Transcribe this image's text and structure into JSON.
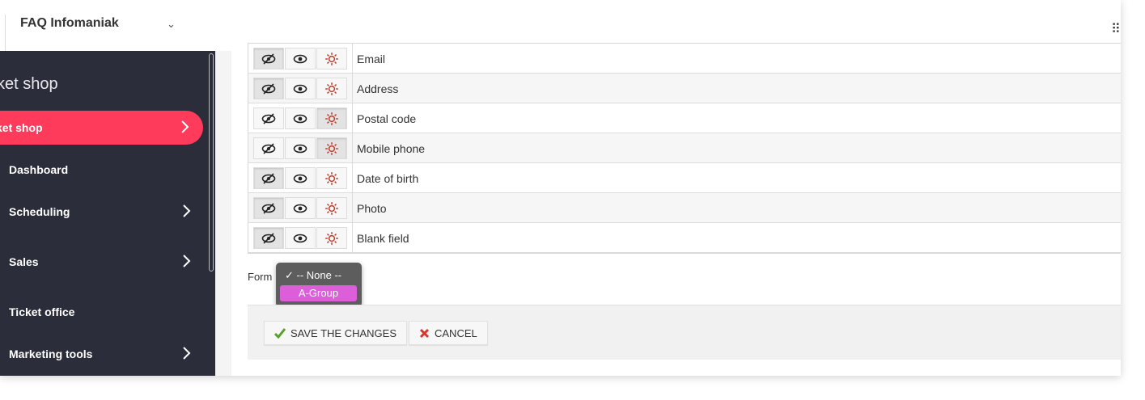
{
  "topbar": {
    "org_name": "FAQ Infomaniak"
  },
  "sidebar": {
    "heading": "ket shop",
    "active_item": "ket shop",
    "items": [
      "Dashboard",
      "Scheduling",
      "Sales",
      "Ticket office",
      "Marketing tools"
    ]
  },
  "fields": [
    {
      "label": "Email",
      "state": "hidden"
    },
    {
      "label": "Address",
      "state": "hidden"
    },
    {
      "label": "Postal code",
      "state": "required"
    },
    {
      "label": "Mobile phone",
      "state": "required"
    },
    {
      "label": "Date of birth",
      "state": "hidden"
    },
    {
      "label": "Photo",
      "state": "hidden"
    },
    {
      "label": "Blank field",
      "state": "hidden"
    }
  ],
  "form": {
    "label": "Form",
    "options": [
      "-- None --",
      "A-Group"
    ],
    "selected": "-- None --",
    "highlighted": "A-Group"
  },
  "footer": {
    "save_label": "SAVE THE CHANGES",
    "cancel_label": "CANCEL"
  },
  "colors": {
    "sidebar_bg": "#2b2e3a",
    "accent": "#ff3b5c",
    "dropdown_highlight": "#dc5ed9",
    "gear": "#c0392b"
  }
}
